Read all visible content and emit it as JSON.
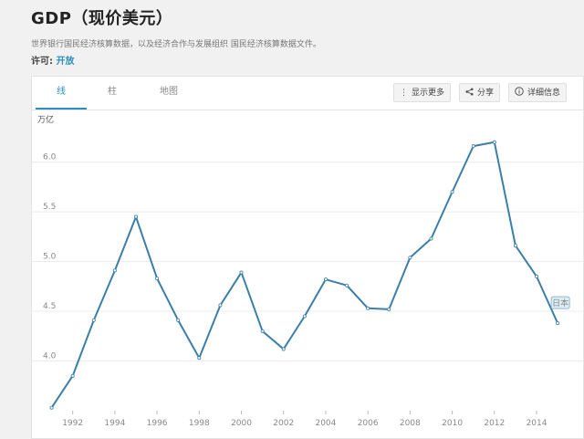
{
  "header": {
    "title": "GDP（现价美元）",
    "source": "世界银行国民经济核算数据，以及经济合作与发展组织 国民经济核算数据文件。",
    "license_label": "许可: ",
    "license_value": "开放"
  },
  "tabs": [
    {
      "label": "线"
    },
    {
      "label": "柱"
    },
    {
      "label": "地图"
    }
  ],
  "toolbar": {
    "more": "显示更多",
    "share": "分享",
    "details": "详细信息"
  },
  "colors": {
    "accent": "#2a8fbd",
    "line": "#3b7fa8"
  },
  "chart_data": {
    "type": "line",
    "ylabel": "万亿",
    "ylim": [
      3.5,
      6.4
    ],
    "yticks": [
      4.0,
      4.5,
      5.0,
      5.5,
      6.0
    ],
    "xlim": [
      1990.5,
      2015.6
    ],
    "xticks": [
      1992,
      1994,
      1996,
      1998,
      2000,
      2002,
      2004,
      2006,
      2008,
      2010,
      2012,
      2014
    ],
    "grid": true,
    "series": [
      {
        "name": "日本",
        "x": [
          1991,
          1992,
          1993,
          1994,
          1995,
          1996,
          1997,
          1998,
          1999,
          2000,
          2001,
          2002,
          2003,
          2004,
          2005,
          2006,
          2007,
          2008,
          2009,
          2010,
          2011,
          2012,
          2013,
          2014,
          2015
        ],
        "values": [
          3.53,
          3.85,
          4.41,
          4.91,
          5.45,
          4.83,
          4.41,
          4.03,
          4.56,
          4.89,
          4.3,
          4.12,
          4.45,
          4.82,
          4.76,
          4.53,
          4.52,
          5.04,
          5.23,
          5.7,
          6.16,
          6.2,
          5.16,
          4.85,
          4.38
        ]
      }
    ]
  }
}
